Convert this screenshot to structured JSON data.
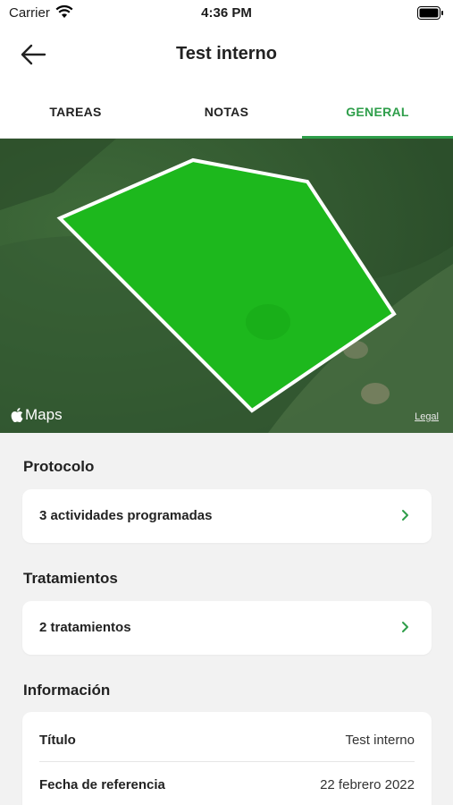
{
  "status_bar": {
    "carrier": "Carrier",
    "time": "4:36 PM"
  },
  "header": {
    "title": "Test interno"
  },
  "tabs": [
    {
      "label": "TAREAS",
      "active": false
    },
    {
      "label": "NOTAS",
      "active": false
    },
    {
      "label": "GENERAL",
      "active": true
    }
  ],
  "map": {
    "provider_label": "Maps",
    "legal_label": "Legal",
    "field_color": "#1db81d"
  },
  "sections": {
    "protocolo": {
      "title": "Protocolo",
      "row_label": "3 actividades programadas"
    },
    "tratamientos": {
      "title": "Tratamientos",
      "row_label": "2 tratamientos"
    },
    "informacion": {
      "title": "Información",
      "rows": [
        {
          "key": "Título",
          "value": "Test interno"
        },
        {
          "key": "Fecha de referencia",
          "value": "22 febrero 2022"
        }
      ]
    }
  },
  "colors": {
    "accent": "#2e9e4a",
    "background": "#f2f2f2"
  }
}
